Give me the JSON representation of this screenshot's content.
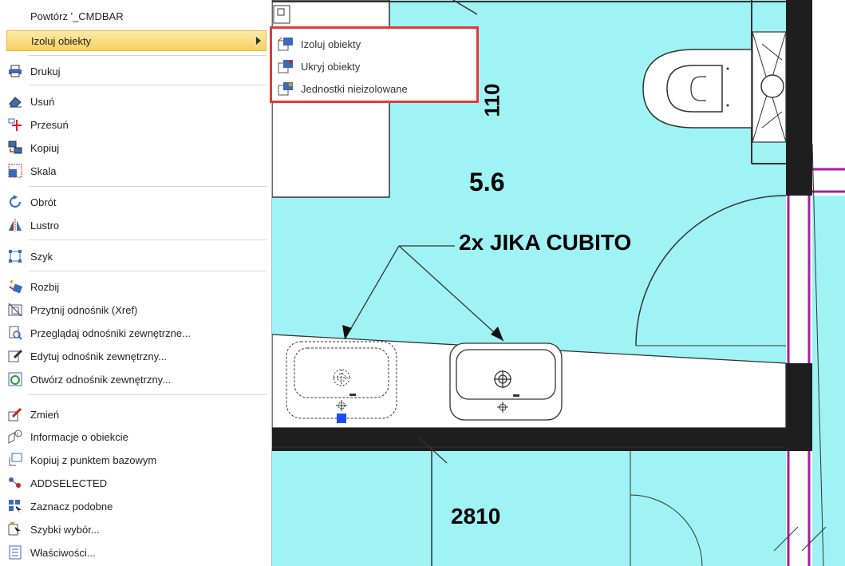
{
  "context_menu": {
    "items": [
      {
        "label": "Powtórz '_CMDBAR",
        "icon": "none"
      },
      {
        "label": "Izoluj obiekty",
        "icon": "none",
        "highlighted": true,
        "submenu": true
      },
      {
        "label": "Drukuj",
        "icon": "printer-icon"
      },
      {
        "label": "Usuń",
        "icon": "eraser-icon"
      },
      {
        "label": "Przesuń",
        "icon": "move-icon"
      },
      {
        "label": "Kopiuj",
        "icon": "copy-icon"
      },
      {
        "label": "Skala",
        "icon": "scale-icon"
      },
      {
        "label": "Obrót",
        "icon": "rotate-icon"
      },
      {
        "label": "Lustro",
        "icon": "mirror-icon"
      },
      {
        "label": "Szyk",
        "icon": "array-icon"
      },
      {
        "label": "Rozbij",
        "icon": "explode-icon"
      },
      {
        "label": "Przytnij odnośnik (Xref)",
        "icon": "clip-xref-icon"
      },
      {
        "label": "Przeglądaj odnośniki zewnętrzne...",
        "icon": "browse-xref-icon"
      },
      {
        "label": "Edytuj odnośnik zewnętrzny...",
        "icon": "edit-xref-icon"
      },
      {
        "label": "Otwórz odnośnik zewnętrzny...",
        "icon": "open-xref-icon"
      },
      {
        "label": "Zmień",
        "icon": "modify-icon"
      },
      {
        "label": "Informacje o obiekcie",
        "icon": "object-info-icon"
      },
      {
        "label": "Kopiuj z punktem bazowym",
        "icon": "copy-base-point-icon"
      },
      {
        "label": "ADDSELECTED",
        "icon": "add-selected-icon"
      },
      {
        "label": "Zaznacz podobne",
        "icon": "select-similar-icon"
      },
      {
        "label": "Szybki wybór...",
        "icon": "quick-select-icon"
      },
      {
        "label": "Właściwości...",
        "icon": "properties-icon"
      }
    ]
  },
  "submenu": {
    "items": [
      {
        "label": "Izoluj obiekty",
        "icon": "isolate-objects-icon"
      },
      {
        "label": "Ukryj obiekty",
        "icon": "hide-objects-icon"
      },
      {
        "label": "Jednostki nieizolowane",
        "icon": "end-isolation-icon"
      }
    ]
  },
  "drawing": {
    "dim_110": "110",
    "room_number": "5.6",
    "annotation": "2x JIKA CUBITO",
    "dim_2810": "2810"
  },
  "colors": {
    "floor_fill": "#9ff3f5",
    "wall": "#1e1e1e",
    "door_frame": "#a020a0",
    "grip": "#1a4cff",
    "menu_highlight": "#f7d062",
    "submenu_border": "#e53935"
  }
}
